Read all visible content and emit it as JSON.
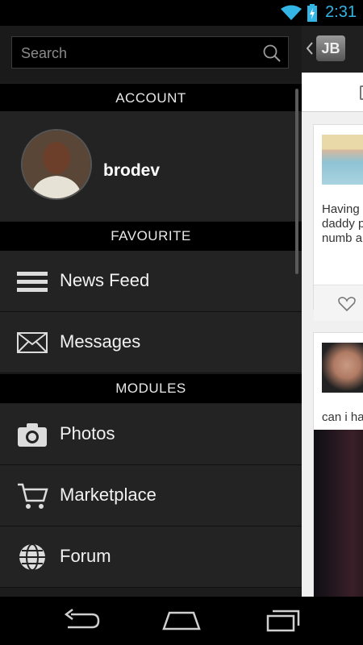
{
  "status_bar": {
    "time": "2:31",
    "wifi_icon": "wifi-icon",
    "battery_icon": "battery-charging-icon",
    "accent": "#33b5e5"
  },
  "drawer": {
    "search": {
      "placeholder": "Search"
    },
    "sections": {
      "account": "ACCOUNT",
      "favourite": "FAVOURITE",
      "modules": "MODULES"
    },
    "user": {
      "name": "brodev"
    },
    "favourites": [
      {
        "label": "News Feed",
        "icon": "list-icon"
      },
      {
        "label": "Messages",
        "icon": "envelope-icon"
      }
    ],
    "modules": [
      {
        "label": "Photos",
        "icon": "camera-icon"
      },
      {
        "label": "Marketplace",
        "icon": "cart-icon"
      },
      {
        "label": "Forum",
        "icon": "globe-icon"
      }
    ]
  },
  "content": {
    "logo": "JB",
    "posts": [
      {
        "text_lines": [
          "Having",
          "daddy p",
          "numb a"
        ]
      },
      {
        "text_lines": [
          "can i ha"
        ]
      }
    ]
  },
  "nav": {
    "back": "back-icon",
    "home": "home-icon",
    "recent": "recent-apps-icon"
  }
}
